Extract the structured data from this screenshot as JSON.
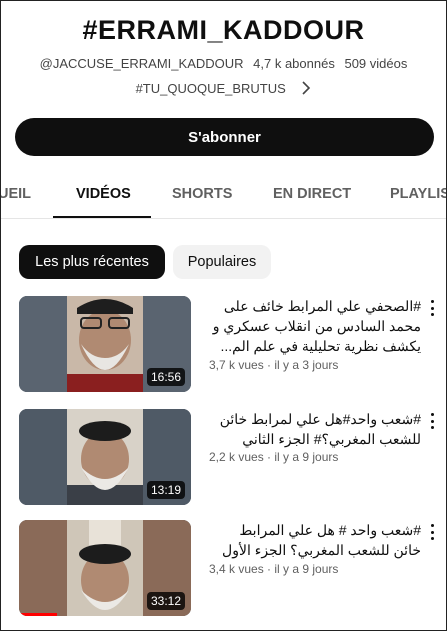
{
  "channel": {
    "title": "#ERRAMI_KADDOUR",
    "handle": "@JACCUSE_ERRAMI_KADDOUR",
    "subscribers": "4,7 k abonnés",
    "videos_count": "509 vidéos",
    "tagline": "#TU_QUOQUE_BRUTUS"
  },
  "subscribe_label": "S'abonner",
  "tabs": [
    {
      "label": "UEIL"
    },
    {
      "label": "VIDÉOS"
    },
    {
      "label": "SHORTS"
    },
    {
      "label": "EN DIRECT"
    },
    {
      "label": "PLAYLIS"
    }
  ],
  "filters": [
    {
      "label": "Les plus récentes"
    },
    {
      "label": "Populaires"
    }
  ],
  "videos": [
    {
      "title": "#الصحفي علي المرابط خائف على محمد السادس من انقلاب عسكري و يكشف نظرية تحليلية في علم الم...",
      "meta": "3,7 k vues · il y a 3 jours",
      "duration": "16:56",
      "watched_fraction": 0
    },
    {
      "title": "#شعب واحد#هل علي لمرابط خائن للشعب المغربي؟# الجزء الثاني",
      "meta": "2,2 k vues · il y a 9 jours",
      "duration": "13:19",
      "watched_fraction": 0
    },
    {
      "title": "#شعب واحد # هل علي المرابط خائن للشعب المغربي؟ الجزء الأول",
      "meta": "3,4 k vues · il y a 9 jours",
      "duration": "33:12",
      "watched_fraction": 0.22
    }
  ],
  "icons": [
    "chevron-right-icon",
    "more-vert-icon"
  ],
  "colors": {
    "accent": "#0f0f0f",
    "progress": "#ff0000",
    "chip_inactive": "#f2f2f2"
  }
}
